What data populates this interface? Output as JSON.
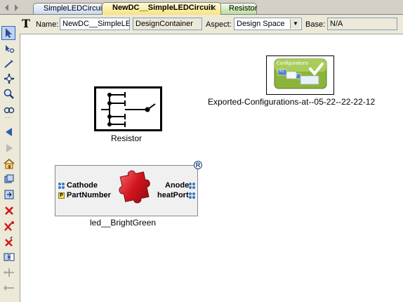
{
  "tabs": [
    {
      "label": "SimpleLEDCircuit"
    },
    {
      "label": "NewDC__SimpleLEDCircuit",
      "close": "✕"
    },
    {
      "label": "Resistor"
    }
  ],
  "properties": {
    "tool_glyph": "T",
    "name_label": "Name:",
    "name_value": "NewDC__SimpleLEDCircuit",
    "kind_value": "DesignContainer",
    "aspect_label": "Aspect:",
    "aspect_value": "Design Space",
    "base_label": "Base:",
    "base_value": "N/A"
  },
  "toolbar": {
    "items": [
      "select-pointer",
      "zoom-tool",
      "connect-tool",
      "pan-tool",
      "magnifier-tool",
      "zoom-fit-tool",
      "navigate-back",
      "navigate-forward",
      "home",
      "cycle-aspect",
      "cycle-ports",
      "delete",
      "delete-connections",
      "delete-selected",
      "split-tool",
      "add-connection",
      "remove-connection"
    ]
  },
  "canvas": {
    "configurations": {
      "caption": "Exported-Configurations-at--05-22--22-22-12",
      "icon_title": "Configurations",
      "icon_badge_1": "#1",
      "icon_badge_2": "#2"
    },
    "resistor": {
      "caption": "Resistor"
    },
    "led": {
      "caption": "led__BrightGreen",
      "reference_badge": "R",
      "ports_left": [
        "Cathode",
        "PartNumber"
      ],
      "ports_right": [
        "Anode",
        "heatPort"
      ],
      "param_badge": "P"
    }
  },
  "colors": {
    "tab_active": "#f8e27e",
    "tab_inactive": "#c9d9f3",
    "tab_resistor": "#b9dfa0",
    "config_green": "#8cb43c",
    "puzzle_red": "#d0141e",
    "port_blue": "#3a7ac2"
  }
}
